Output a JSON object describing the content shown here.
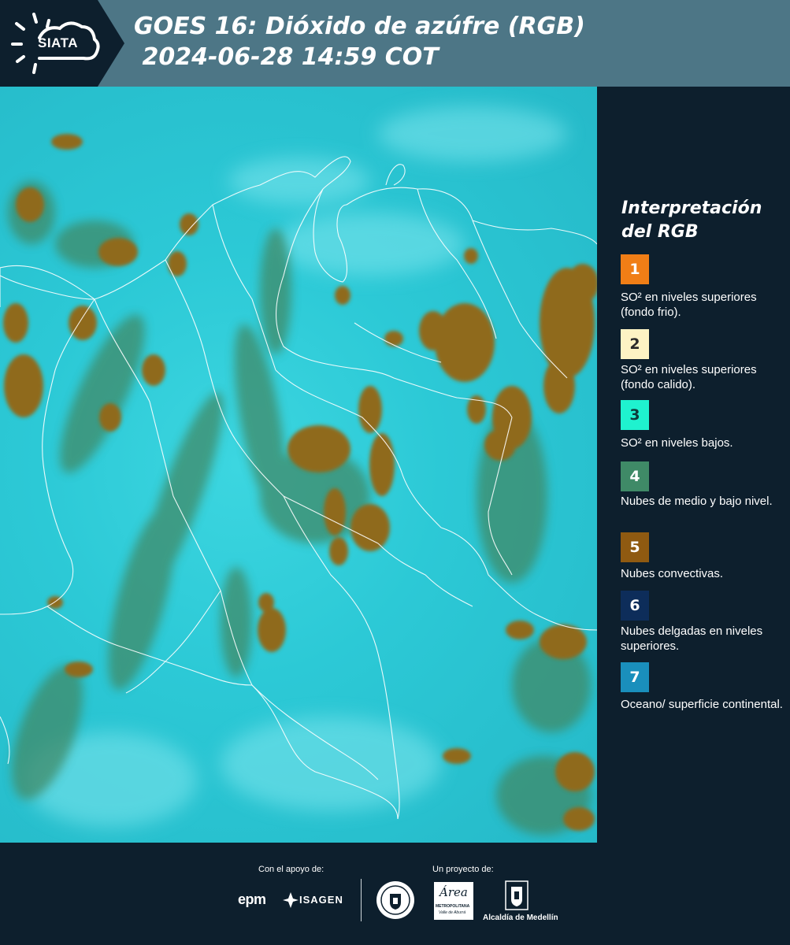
{
  "header": {
    "logo_text": "SIATA",
    "title_line1": "GOES 16: Dióxido de azúfre (RGB)",
    "title_line2": " 2024-06-28 14:59 COT"
  },
  "legend": {
    "title": "Interpretación del RGB",
    "items": [
      {
        "number": "1",
        "color": "#f07e16",
        "description": "SO² en niveles superiores (fondo frio)."
      },
      {
        "number": "2",
        "color": "#fdf3c4",
        "description": "SO² en niveles superiores (fondo calido)."
      },
      {
        "number": "3",
        "color": "#1ff2cf",
        "description": "SO² en niveles bajos."
      },
      {
        "number": "4",
        "color": "#3f8a67",
        "description": "Nubes de medio y bajo nivel."
      },
      {
        "number": "5",
        "color": "#8f5a11",
        "description": "Nubes convectivas."
      },
      {
        "number": "6",
        "color": "#0d2d5a",
        "description": "Nubes delgadas en niveles superiores."
      },
      {
        "number": "7",
        "color": "#1a8fbc",
        "description": "Oceano/ superficie continental."
      }
    ]
  },
  "footer": {
    "support_label": "Con el apoyo de:",
    "project_label": "Un proyecto de:",
    "sponsor_epm": "epm",
    "sponsor_isagen": "ISAGEN",
    "partner_area_main": "Área",
    "partner_area_sub1": "METROPOLITANA",
    "partner_area_sub2": "Valle de Aburrá",
    "partner_alcaldia": "Alcaldía de Medellín"
  },
  "colors": {
    "header_bg": "#4d7686",
    "panel_bg": "#0d1f2d",
    "map_background": "#2cc9d6",
    "convective_cloud": "#8f6a1c",
    "low_cloud": "#3f8a67"
  }
}
